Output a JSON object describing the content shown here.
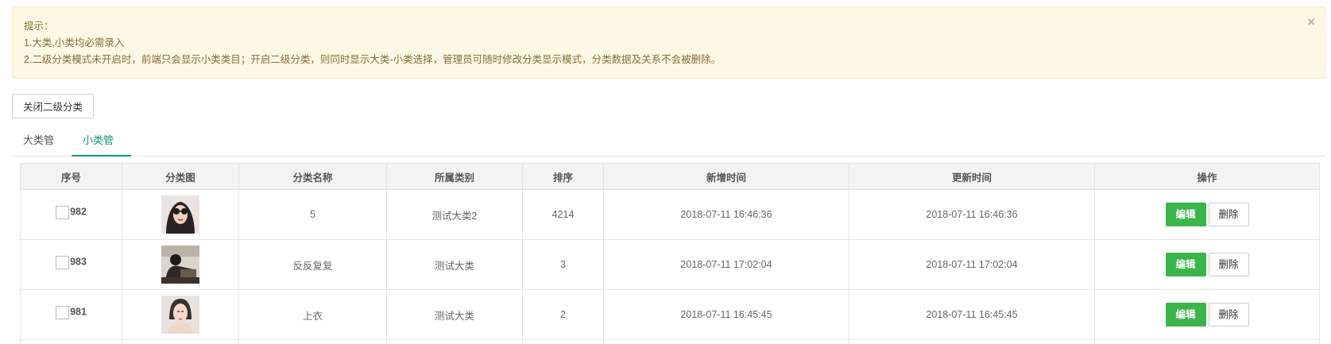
{
  "alert": {
    "title": "提示：",
    "line1": "1.大类,小类均必需录入",
    "line2": "2.二级分类模式未开启时，前端只会显示小类类目；开启二级分类，则同时显示大类-小类选择，管理员可随时修改分类显示模式，分类数据及关系不会被删除。",
    "close": "×"
  },
  "toggle_button": "关闭二级分类",
  "tabs": [
    {
      "label": "大类管理",
      "active": false
    },
    {
      "label": "小类管理",
      "active": true
    }
  ],
  "table": {
    "headers": [
      "序号",
      "分类图",
      "分类名称",
      "所属类别",
      "排序",
      "新增时间",
      "更新时间",
      "操作"
    ],
    "rows": [
      {
        "id": "982",
        "name": "5",
        "category": "测试大类2",
        "sort": "4214",
        "created": "2018-07-11 16:46:36",
        "updated": "2018-07-11 16:46:36"
      },
      {
        "id": "983",
        "name": "反反复复",
        "category": "测试大类",
        "sort": "3",
        "created": "2018-07-11 17:02:04",
        "updated": "2018-07-11 17:02:04"
      },
      {
        "id": "981",
        "name": "上衣",
        "category": "测试大类",
        "sort": "2",
        "created": "2018-07-11 16:45:45",
        "updated": "2018-07-11 16:45:45"
      }
    ],
    "edit_label": "编辑",
    "delete_label": "删除"
  },
  "colors": {
    "accent": "#0e9a6e",
    "edit_button": "#3bb44a",
    "alert_bg": "#fcf8e3",
    "alert_text": "#8a6d3b"
  }
}
